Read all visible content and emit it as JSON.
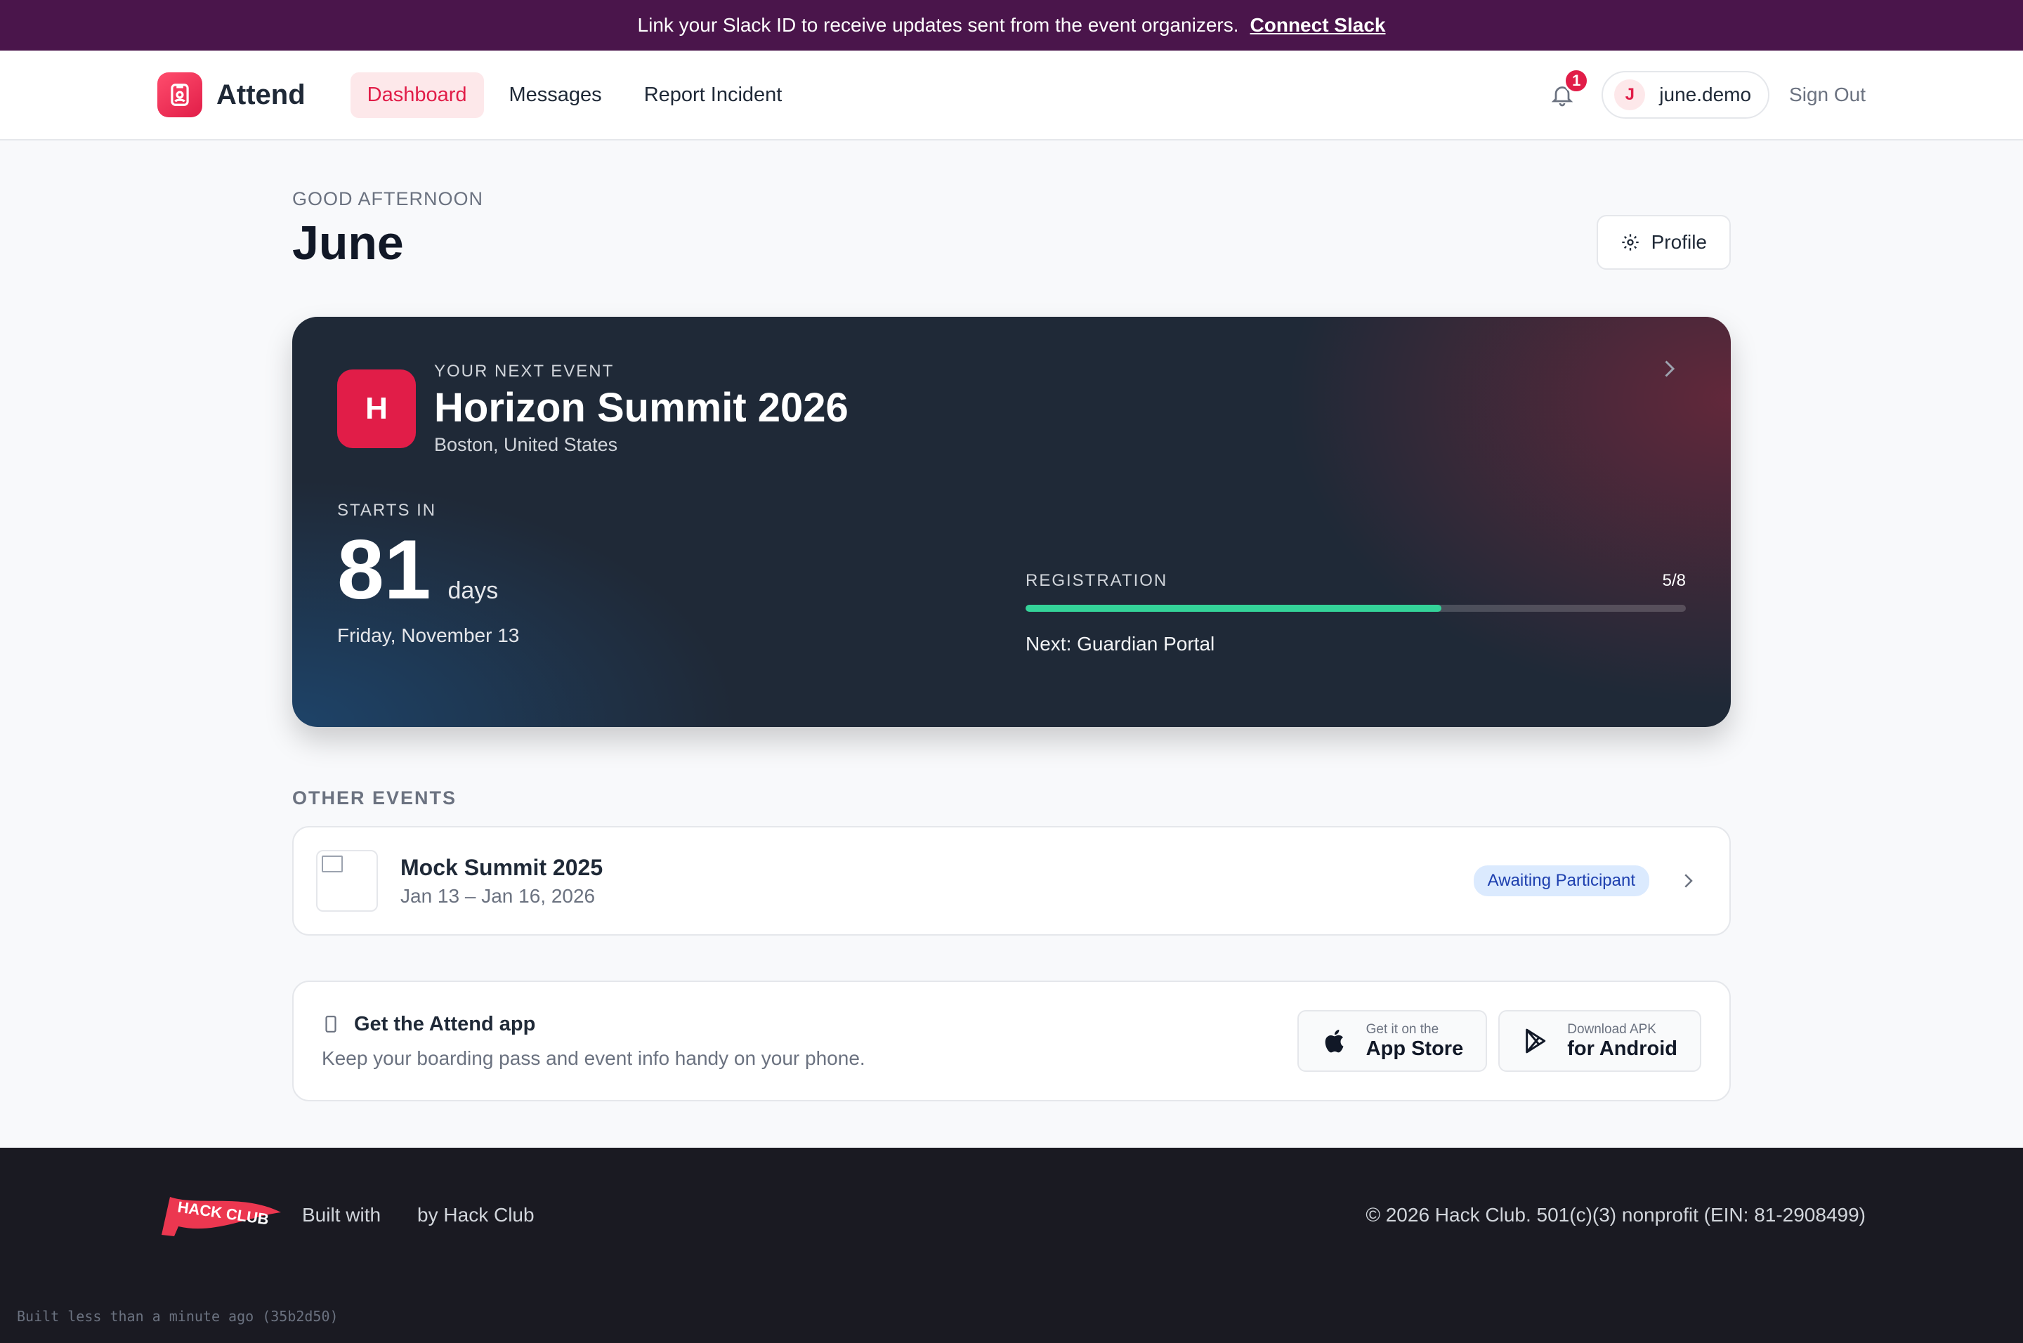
{
  "banner": {
    "text": "Link your Slack ID to receive updates sent from the event organizers.",
    "link": "Connect Slack"
  },
  "nav": {
    "brand": "Attend",
    "links": [
      "Dashboard",
      "Messages",
      "Report Incident"
    ],
    "active": "Dashboard",
    "notification_count": "1",
    "user_initial": "J",
    "username": "june.demo",
    "sign_out": "Sign Out"
  },
  "header": {
    "greeting": "GOOD AFTERNOON",
    "name": "June",
    "profile_button": "Profile"
  },
  "next_event": {
    "label": "YOUR NEXT EVENT",
    "icon_letter": "H",
    "title": "Horizon Summit 2026",
    "location": "Boston, United States",
    "starts_label": "STARTS IN",
    "days": "81",
    "days_unit": "days",
    "date": "Friday, November 13",
    "registration_label": "REGISTRATION",
    "registration_count": "5/8",
    "registration_progress": 0.63,
    "next_step": "Next: Guardian Portal"
  },
  "other_events": {
    "title": "OTHER EVENTS",
    "items": [
      {
        "title": "Mock Summit 2025",
        "dates": "Jan 13 – Jan 16, 2026",
        "status": "Awaiting Participant"
      }
    ]
  },
  "app_promo": {
    "title": "Get the Attend app",
    "subtitle": "Keep your boarding pass and event info handy on your phone.",
    "ios_small": "Get it on the",
    "ios_big": "App Store",
    "android_small": "Download APK",
    "android_big": "for Android"
  },
  "footer": {
    "logo_text": "HACK CLUB",
    "built_with": "Built with",
    "by": "by Hack Club",
    "copyright": "© 2026 Hack Club. 501(c)(3) nonprofit (EIN: 81-2908499)",
    "build_info": "Built less than a minute ago (35b2d50)"
  },
  "colors": {
    "accent": "#e11d48",
    "slack_banner": "#4a154b",
    "progress": "#34d399"
  }
}
